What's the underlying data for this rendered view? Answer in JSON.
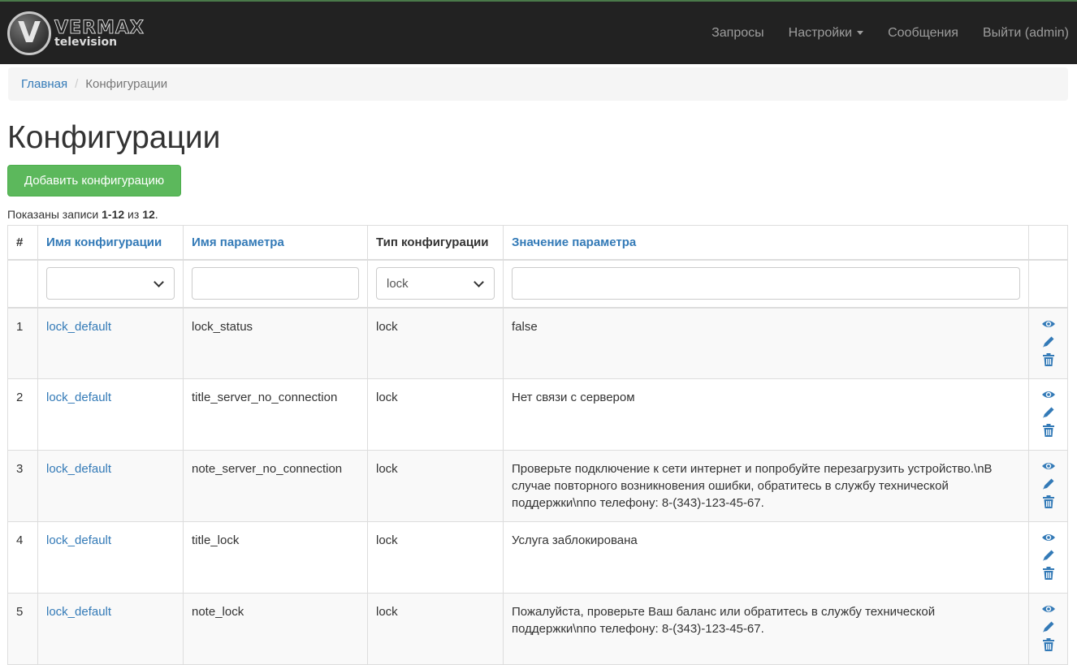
{
  "brand": {
    "logo_letter": "V",
    "name_top": "VERMAX",
    "name_bottom": "television"
  },
  "nav": {
    "requests": "Запросы",
    "settings": "Настройки",
    "messages": "Сообщения",
    "logout": "Выйти (admin)"
  },
  "breadcrumb": {
    "home": "Главная",
    "separator": "/",
    "current": "Конфигурации"
  },
  "page_title": "Конфигурации",
  "add_button": "Добавить конфигурацию",
  "summary": {
    "prefix": "Показаны записи ",
    "range": "1-12",
    "of": " из ",
    "total": "12",
    "suffix": "."
  },
  "table": {
    "headers": {
      "index": "#",
      "config_name": "Имя конфигурации",
      "param_name": "Имя параметра",
      "config_type": "Тип конфигурации",
      "param_value": "Значение параметра"
    },
    "filters": {
      "config_name_value": "",
      "param_name_value": "",
      "config_type_value": "lock",
      "param_value_value": ""
    },
    "rows": [
      {
        "index": "1",
        "config_name": "lock_default",
        "param_name": "lock_status",
        "config_type": "lock",
        "param_value": "false"
      },
      {
        "index": "2",
        "config_name": "lock_default",
        "param_name": "title_server_no_connection",
        "config_type": "lock",
        "param_value": "Нет связи с сервером"
      },
      {
        "index": "3",
        "config_name": "lock_default",
        "param_name": "note_server_no_connection",
        "config_type": "lock",
        "param_value": "Проверьте подключение к сети интернет и попробуйте перезагрузить устройство.\\nВ случае повторного возникновения ошибки, обратитесь в службу технической поддержки\\nпо телефону: 8-(343)-123-45-67."
      },
      {
        "index": "4",
        "config_name": "lock_default",
        "param_name": "title_lock",
        "config_type": "lock",
        "param_value": "Услуга заблокирована"
      },
      {
        "index": "5",
        "config_name": "lock_default",
        "param_name": "note_lock",
        "config_type": "lock",
        "param_value": "Пожалуйста, проверьте Ваш баланс или обратитесь в службу технической поддержки\\nпо телефону: 8-(343)-123-45-67."
      }
    ],
    "row_actions": [
      "eye-icon",
      "pencil-icon",
      "trash-icon"
    ]
  },
  "colors": {
    "navbar_bg": "#222222",
    "link": "#337ab7",
    "success_button": "#5cb85c",
    "breadcrumb_bg": "#f5f5f5"
  }
}
